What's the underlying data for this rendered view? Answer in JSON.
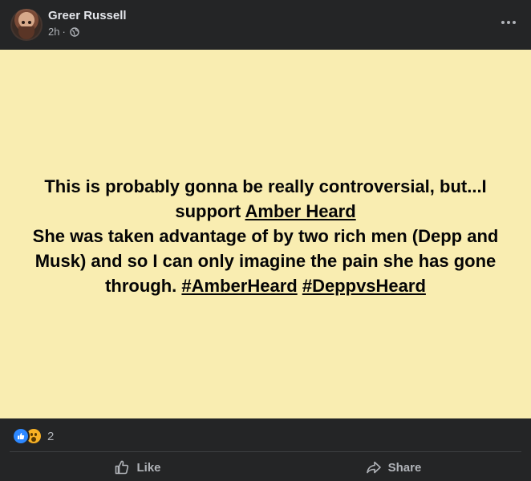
{
  "post": {
    "author": "Greer Russell",
    "time": "2h",
    "separator": "·",
    "privacy_icon": "globe-icon",
    "more_icon": "more-horizontal-icon",
    "background_color": "#f9edb1",
    "text": {
      "line1": "This is probably gonna be really controversial, but...I support",
      "mention": "Amber Heard",
      "line2": "She was taken advantage of by two rich men (Depp and Musk) and so I can only imagine the pain she has gone through.",
      "hashtag1": "#AmberHeard",
      "hashtag2": "#DeppvsHeard"
    }
  },
  "reactions": {
    "icons": [
      "like-reaction-icon",
      "wow-reaction-icon"
    ],
    "count": "2"
  },
  "actions": {
    "like_label": "Like",
    "share_label": "Share"
  },
  "colors": {
    "background": "#242526",
    "text_secondary": "#b0b3b8",
    "like_blue": "#2d88ff",
    "wow_yellow": "#f7b125"
  }
}
